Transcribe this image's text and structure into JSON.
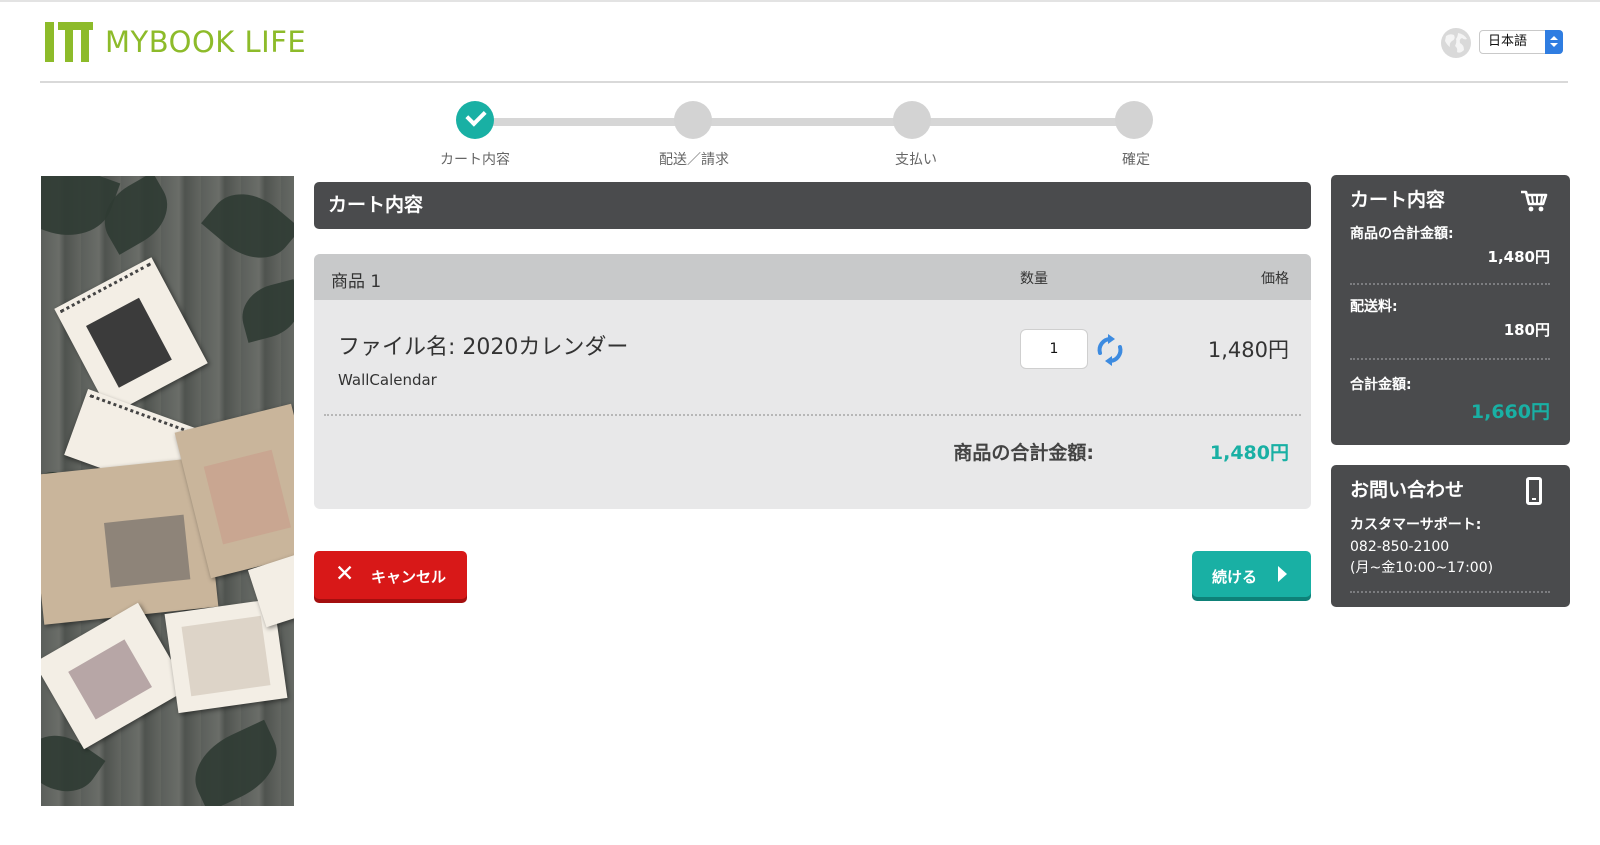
{
  "header": {
    "brand": "MYBOOK LIFE",
    "language": "日本語"
  },
  "stepper": {
    "steps": [
      {
        "label": "カート内容",
        "state": "complete"
      },
      {
        "label": "配送／請求",
        "state": "pending"
      },
      {
        "label": "支払い",
        "state": "pending"
      },
      {
        "label": "確定",
        "state": "pending"
      }
    ]
  },
  "main": {
    "title": "カート内容",
    "table": {
      "item_header": "商品 1",
      "qty_header": "数量",
      "price_header": "価格"
    },
    "item": {
      "name": "ファイル名: 2020カレンダー",
      "type": "WallCalendar",
      "quantity": "1",
      "price": "1,480円"
    },
    "subtotal_label": "商品の合計金額:",
    "subtotal_value": "1,480円"
  },
  "actions": {
    "cancel_label": "キャンセル",
    "continue_label": "続ける"
  },
  "summary": {
    "title": "カート内容",
    "product_total_label": "商品の合計金額:",
    "product_total_value": "1,480円",
    "shipping_label": "配送料:",
    "shipping_value": "180円",
    "grand_total_label": "合計金額:",
    "grand_total_value": "1,660円"
  },
  "contact": {
    "title": "お問い合わせ",
    "support_label": "カスタマーサポート:",
    "phone": "082-850-2100",
    "hours": "(月~金10:00~17:00)"
  },
  "colors": {
    "brand_green": "#8dbb2a",
    "accent_teal": "#19b0a4",
    "cancel_red": "#d81818",
    "panel_dark": "#4a4b4d"
  },
  "icons": [
    "globe-icon",
    "check-icon",
    "refresh-icon",
    "cart-icon",
    "phone-icon",
    "close-icon",
    "arrow-right-icon"
  ]
}
